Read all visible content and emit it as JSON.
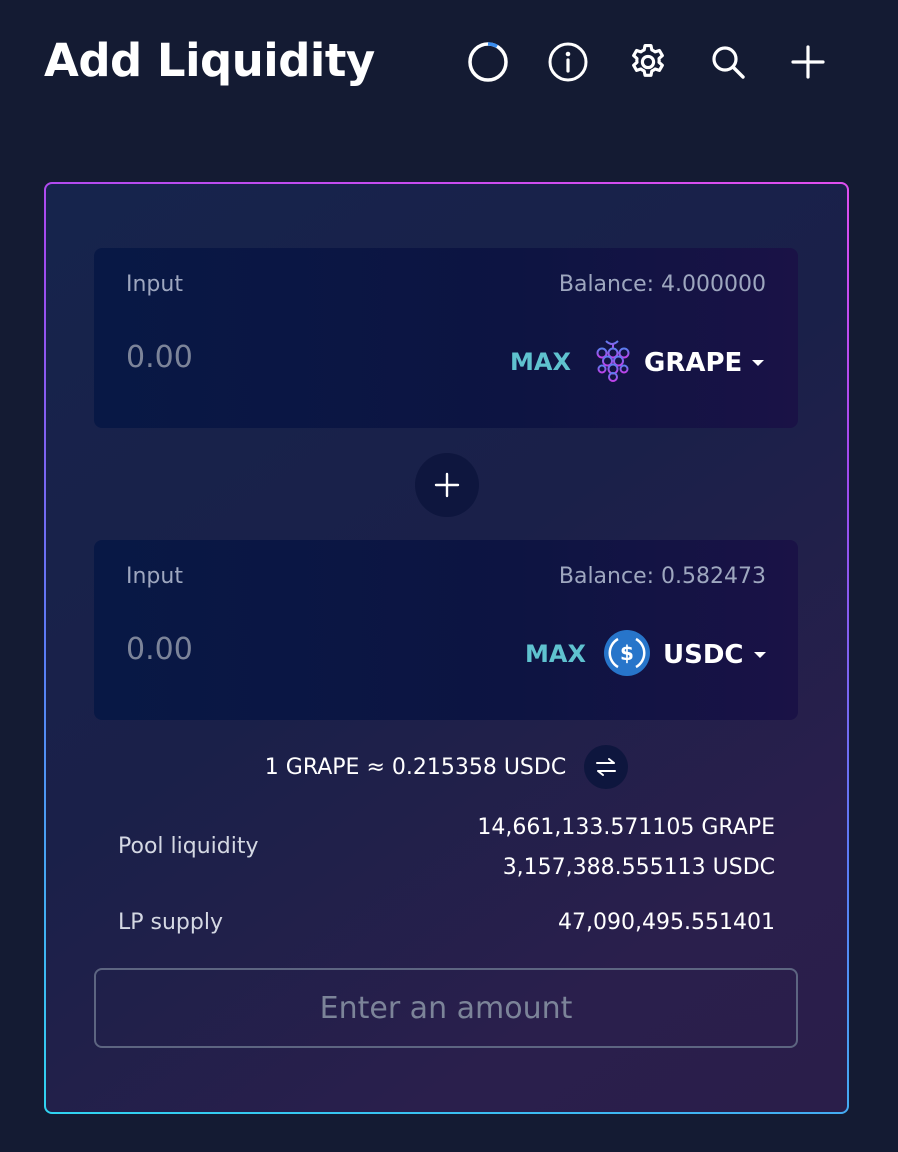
{
  "header": {
    "title": "Add Liquidity",
    "icons": [
      "refresh-icon",
      "info-icon",
      "gear-icon",
      "search-icon",
      "plus-icon"
    ]
  },
  "input_a": {
    "label": "Input",
    "balance": "Balance: 4.000000",
    "placeholder": "0.00",
    "max_label": "MAX",
    "token": "GRAPE",
    "token_icon": "grape-icon"
  },
  "input_b": {
    "label": "Input",
    "balance": "Balance: 0.582473",
    "placeholder": "0.00",
    "max_label": "MAX",
    "token": "USDC",
    "token_icon": "usdc-icon"
  },
  "rate": {
    "text": "1 GRAPE ≈ 0.215358 USDC"
  },
  "stats": {
    "pool_liquidity_label": "Pool liquidity",
    "pool_liquidity_a": "14,661,133.571105 GRAPE",
    "pool_liquidity_b": "3,157,388.555113 USDC",
    "lp_supply_label": "LP supply",
    "lp_supply_value": "47,090,495.551401"
  },
  "submit": {
    "label": "Enter an amount"
  },
  "colors": {
    "background": "#141b33",
    "accent_max": "#5fc2cf",
    "usdc_blue": "#2775ca",
    "grape_purple": "#8a4bd8"
  }
}
